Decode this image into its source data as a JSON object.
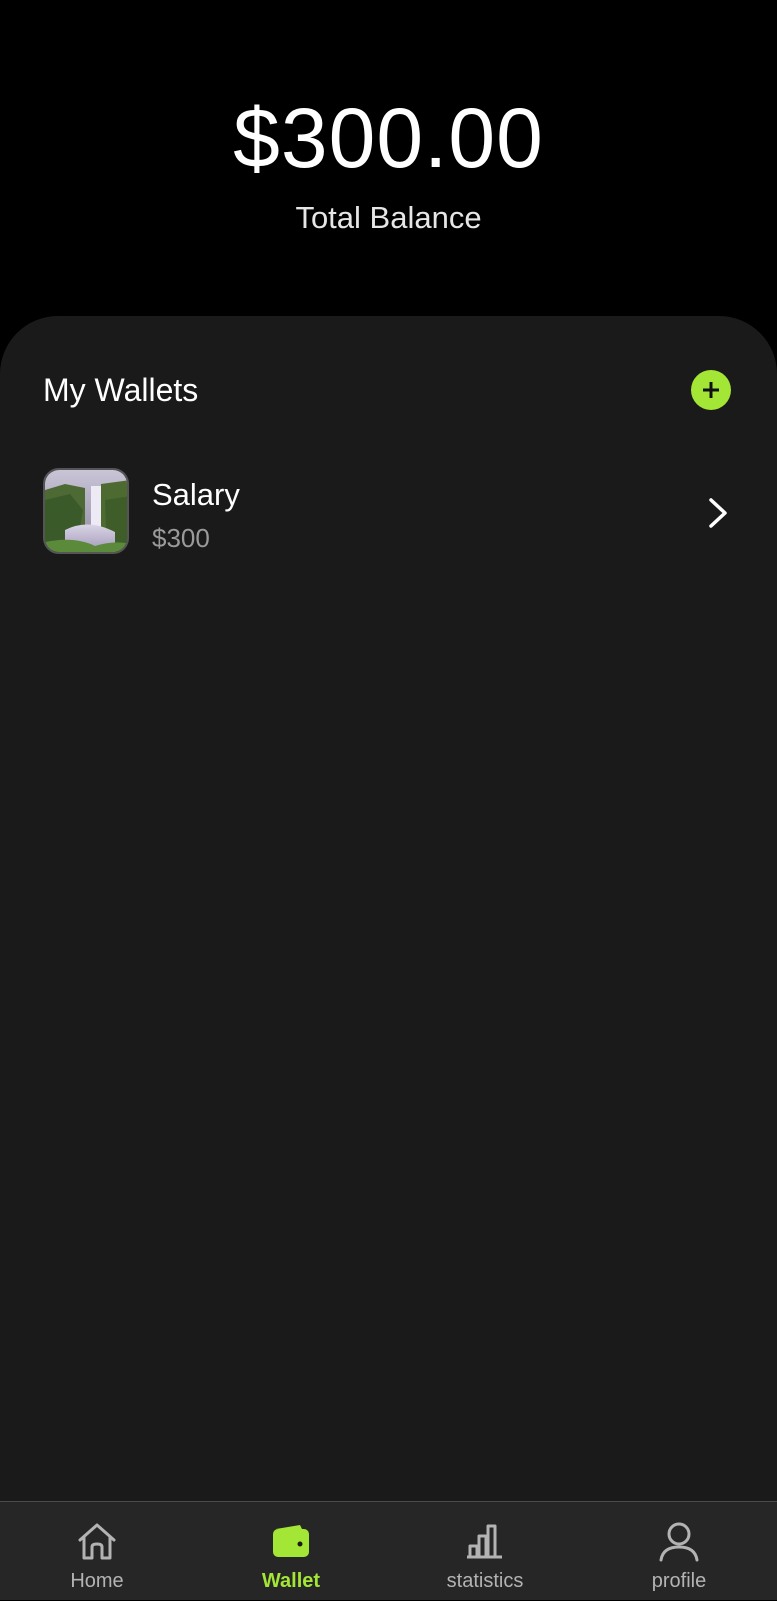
{
  "balance": {
    "amount": "$300.00",
    "label": "Total Balance"
  },
  "wallets_section": {
    "title": "My Wallets",
    "add_icon": "plus-circle-icon",
    "accent_color": "#a3e635",
    "items": [
      {
        "name": "Salary",
        "amount": "$300",
        "thumbnail": "waterfall-photo",
        "chevron_icon": "chevron-right-icon"
      }
    ]
  },
  "nav": {
    "items": [
      {
        "label": "Home",
        "icon": "home-icon",
        "active": false
      },
      {
        "label": "Wallet",
        "icon": "wallet-icon",
        "active": true
      },
      {
        "label": "statistics",
        "icon": "bar-chart-icon",
        "active": false
      },
      {
        "label": "profile",
        "icon": "user-icon",
        "active": false
      }
    ]
  }
}
